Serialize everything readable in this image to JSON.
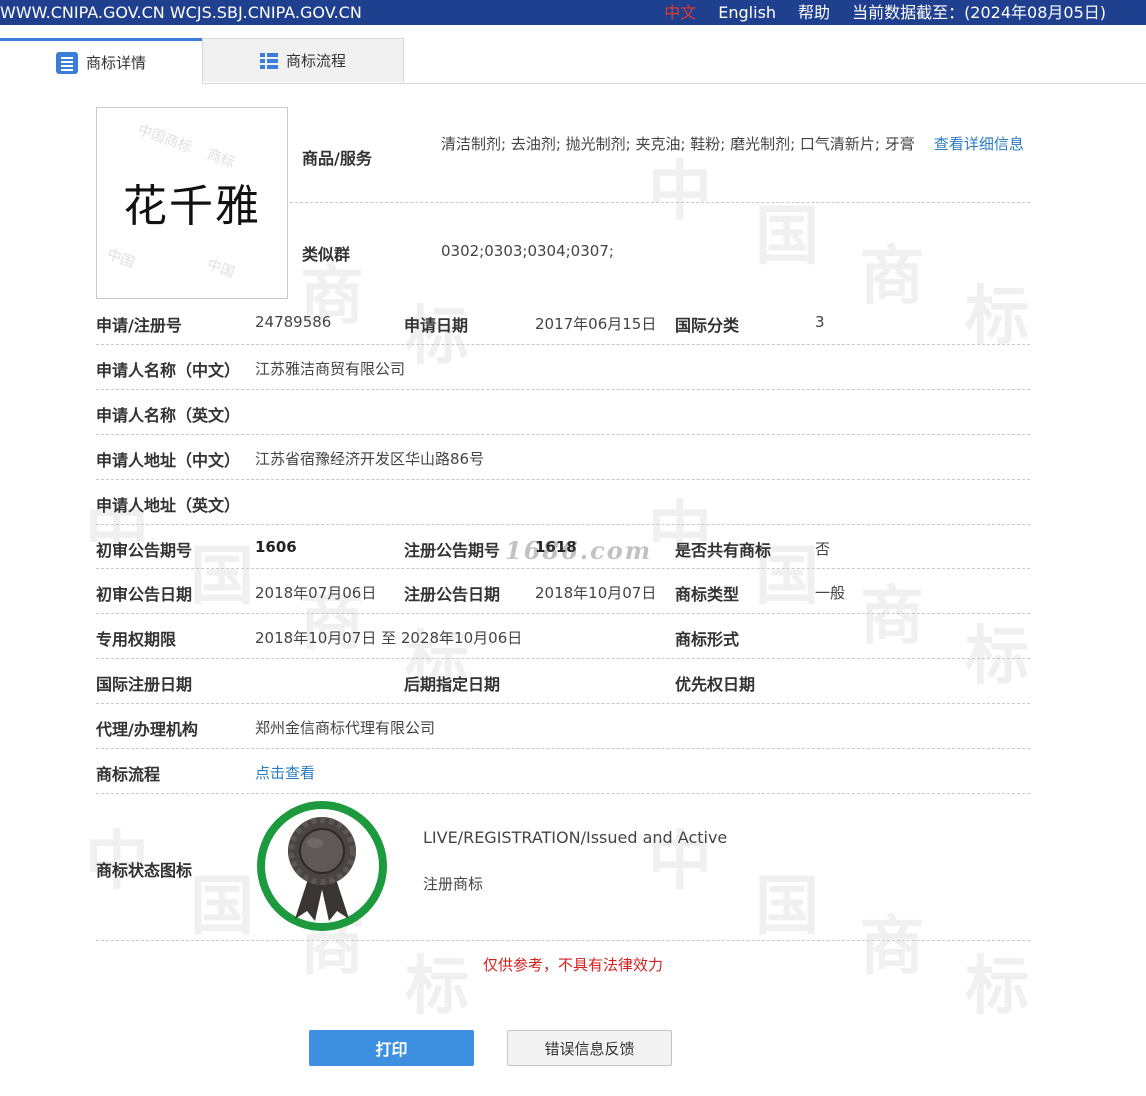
{
  "topbar": {
    "domains": "WWW.CNIPA.GOV.CN WCJS.SBJ.CNIPA.GOV.CN",
    "lang_zh": "中文",
    "lang_en": "English",
    "help": "帮助",
    "data_date": "当前数据截至：(2024年08月05日)"
  },
  "tabs": {
    "detail": "商标详情",
    "flow": "商标流程"
  },
  "logo": {
    "text": "花千雅"
  },
  "goods": {
    "label": "商品/服务",
    "value": "清洁制剂; 去油剂; 抛光制剂; 夹克油; 鞋粉; 磨光制剂; 口气清新片; 牙膏",
    "more_link": "查看详细信息"
  },
  "similar_group": {
    "label": "类似群",
    "value": "0302;0303;0304;0307;"
  },
  "rows": {
    "reg_no_label": "申请/注册号",
    "reg_no": "24789586",
    "apply_date_label": "申请日期",
    "apply_date": "2017年06月15日",
    "intl_class_label": "国际分类",
    "intl_class": "3",
    "applicant_cn_label": "申请人名称（中文）",
    "applicant_cn": "江苏雅洁商贸有限公司",
    "applicant_en_label": "申请人名称（英文）",
    "applicant_en": "",
    "address_cn_label": "申请人地址（中文）",
    "address_cn": "江苏省宿豫经济开发区华山路86号",
    "address_en_label": "申请人地址（英文）",
    "address_en": "",
    "prelim_no_label": "初审公告期号",
    "prelim_no": "1606",
    "reg_notice_no_label": "注册公告期号",
    "reg_notice_no": "1618",
    "shared_label": "是否共有商标",
    "shared": "否",
    "prelim_date_label": "初审公告日期",
    "prelim_date": "2018年07月06日",
    "reg_notice_date_label": "注册公告日期",
    "reg_notice_date": "2018年10月07日",
    "tm_type_label": "商标类型",
    "tm_type": "一般",
    "exclusive_label": "专用权期限",
    "exclusive": "2018年10月07日 至 2028年10月06日",
    "tm_form_label": "商标形式",
    "tm_form": "",
    "intl_reg_date_label": "国际注册日期",
    "intl_reg_date": "",
    "later_date_label": "后期指定日期",
    "later_date": "",
    "priority_date_label": "优先权日期",
    "priority_date": "",
    "agent_label": "代理/办理机构",
    "agent": "郑州金信商标代理有限公司",
    "process_label": "商标流程",
    "process_link": "点击查看",
    "status_label": "商标状态图标",
    "status_en": "LIVE/REGISTRATION/Issued and Active",
    "status_cn": "注册商标"
  },
  "overlay_watermark": "1686.com",
  "disclaimer": "仅供参考，不具有法律效力",
  "buttons": {
    "print": "打印",
    "feedback": "错误信息反馈"
  },
  "colors": {
    "topbar": "#1f3f8f",
    "accent": "#3b7dd8",
    "link": "#2a7bc0",
    "warning": "#d42020",
    "badge_ring": "#1e9a3e"
  }
}
